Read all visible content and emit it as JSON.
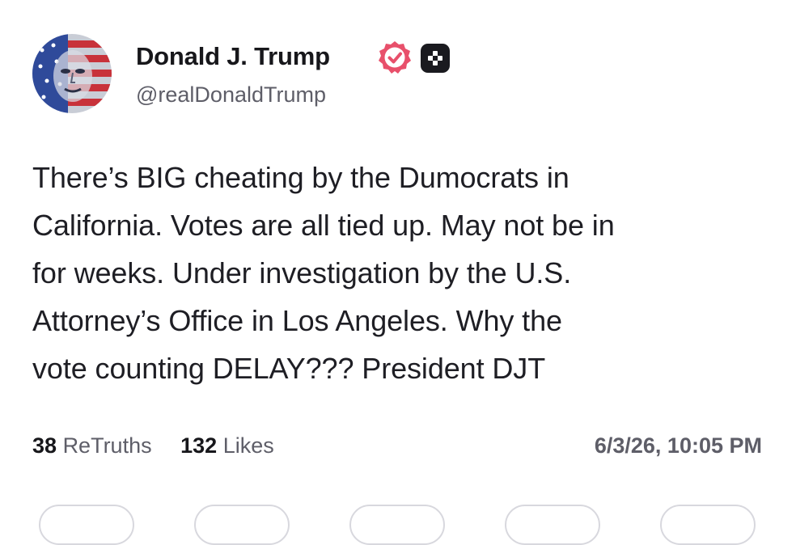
{
  "author": {
    "display_name": "Donald J. Trump",
    "handle": "@realDonaldTrump",
    "avatar_icon": "avatar-image",
    "verified_icon": "verified-badge-icon",
    "plus_icon": "plus-badge-icon",
    "verified_color": "#e8506b"
  },
  "post": {
    "lines": [
      "There’s BIG cheating by the Dumocrats in",
      "California. Votes are all tied up. May not be in",
      "for weeks. Under investigation by the U.S.",
      "Attorney’s Office in Los Angeles. Why the",
      "vote counting DELAY??? President DJT"
    ]
  },
  "stats": {
    "retruths_count": "38",
    "retruths_label": "ReTruths",
    "likes_count": "132",
    "likes_label": "Likes"
  },
  "timestamp": "6/3/26, 10:05 PM",
  "actions": [
    "reply-button",
    "retruth-button",
    "like-button",
    "bookmark-button",
    "share-button"
  ]
}
